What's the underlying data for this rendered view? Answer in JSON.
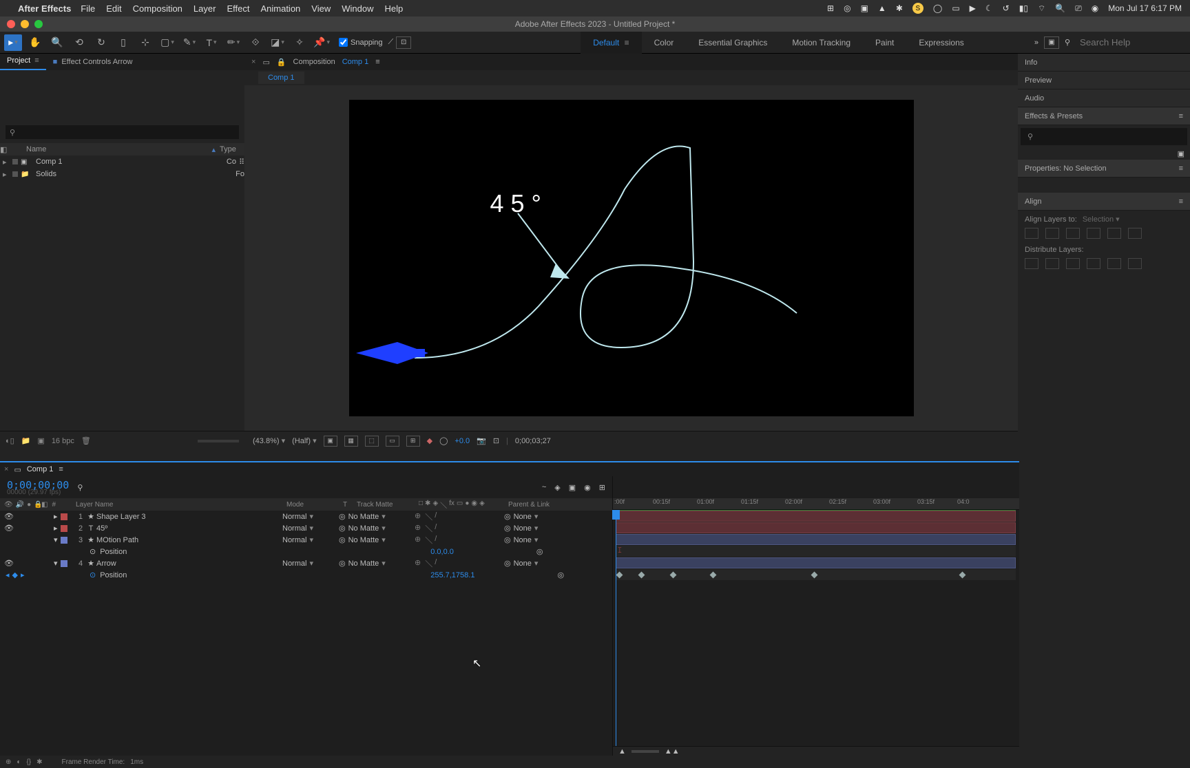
{
  "mac_menu": {
    "app": "After Effects",
    "items": [
      "File",
      "Edit",
      "Composition",
      "Layer",
      "Effect",
      "Animation",
      "View",
      "Window",
      "Help"
    ],
    "clock": "Mon Jul 17  6:17 PM"
  },
  "window_title": "Adobe After Effects 2023 - Untitled Project *",
  "snapping_label": "Snapping",
  "workspaces": {
    "items": [
      "Default",
      "Color",
      "Essential Graphics",
      "Motion Tracking",
      "Paint",
      "Expressions"
    ],
    "active": "Default"
  },
  "search_placeholder": "Search Help",
  "left_panel": {
    "tabs": {
      "project": "Project",
      "effect_controls": "Effect Controls Arrow"
    },
    "columns": {
      "name": "Name",
      "type": "Type"
    },
    "rows": [
      {
        "name": "Comp 1",
        "type": "Co"
      },
      {
        "name": "Solids",
        "type": "Fo"
      }
    ],
    "bpc": "16 bpc"
  },
  "composition": {
    "label": "Composition",
    "name": "Comp 1",
    "overlay_text": "45°"
  },
  "viewer_footer": {
    "zoom": "(43.8%)",
    "res": "(Half)",
    "exposure": "+0.0",
    "timecode": "0;00;03;27"
  },
  "right_panels": {
    "info": "Info",
    "preview": "Preview",
    "audio": "Audio",
    "effects": "Effects & Presets",
    "properties": "Properties: No Selection",
    "align": "Align",
    "align_to_label": "Align Layers to:",
    "align_to_value": "Selection",
    "distribute": "Distribute Layers:"
  },
  "timeline": {
    "tab": "Comp 1",
    "timecode": "0;00;00;00",
    "sub": "00000 (29.97 fps)",
    "ticks": [
      ":00f",
      "00:15f",
      "01:00f",
      "01:15f",
      "02:00f",
      "02:15f",
      "03:00f",
      "03:15f",
      "04:0"
    ],
    "columns": {
      "layer_name": "Layer Name",
      "mode": "Mode",
      "t": "T",
      "track_matte": "Track Matte",
      "parent": "Parent & Link"
    },
    "layers": [
      {
        "idx": "1",
        "color": "sw-r",
        "icon": "★",
        "name": "Shape Layer 3",
        "mode": "Normal",
        "matte": "No Matte",
        "parent": "None"
      },
      {
        "idx": "2",
        "color": "sw-r",
        "icon": "T",
        "name": "45º",
        "mode": "Normal",
        "matte": "No Matte",
        "parent": "None"
      },
      {
        "idx": "3",
        "color": "sw-b",
        "icon": "★",
        "name": "MOtion Path",
        "mode": "Normal",
        "matte": "No Matte",
        "parent": "None",
        "position_label": "Position",
        "position_val": "0.0,0.0"
      },
      {
        "idx": "4",
        "color": "sw-b",
        "icon": "★",
        "name": "Arrow",
        "mode": "Normal",
        "matte": "No Matte",
        "parent": "None",
        "position_label": "Position",
        "position_val": "255.7,1758.1"
      }
    ]
  },
  "status": {
    "label": "Frame Render Time:",
    "value": "1ms"
  }
}
